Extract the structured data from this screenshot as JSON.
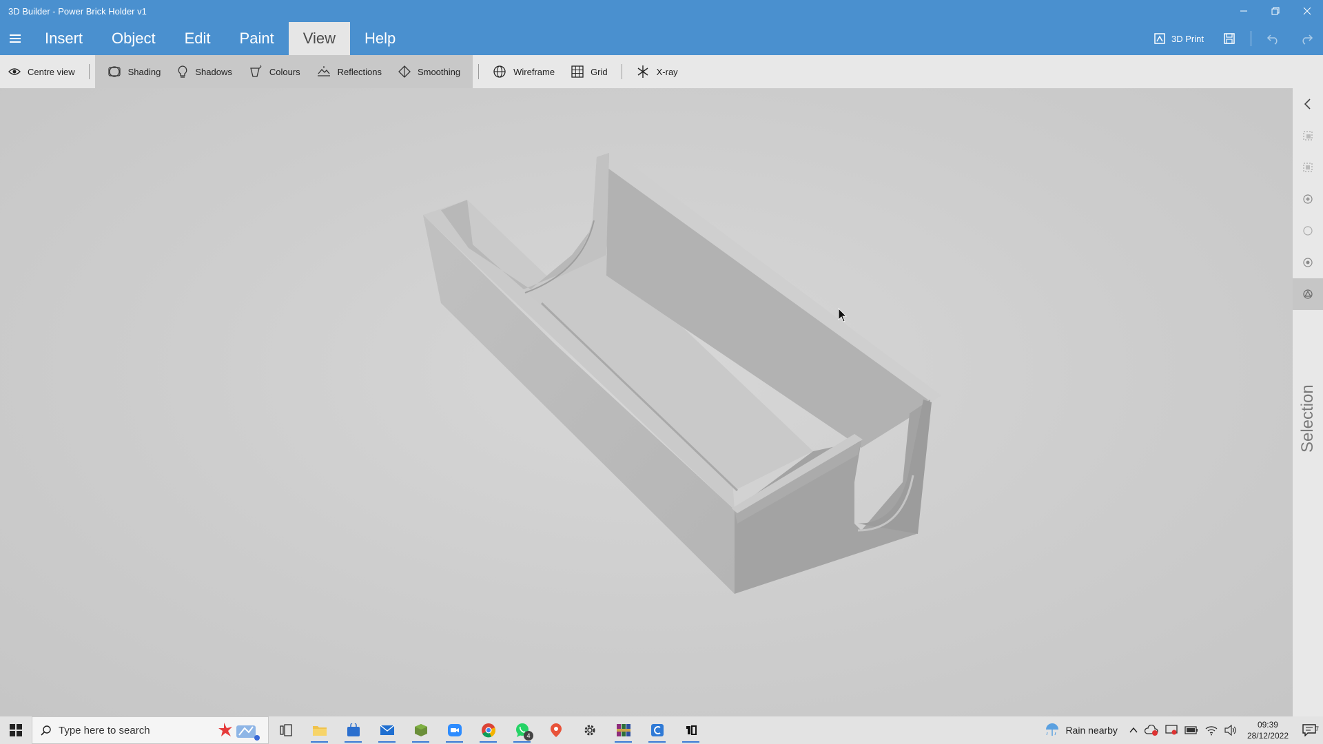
{
  "window": {
    "title": "3D Builder - Power Brick Holder v1",
    "controls": [
      "minimize-icon",
      "restore-icon",
      "close-icon"
    ]
  },
  "menu": {
    "items": [
      {
        "label": "Insert",
        "active": false
      },
      {
        "label": "Object",
        "active": false
      },
      {
        "label": "Edit",
        "active": false
      },
      {
        "label": "Paint",
        "active": false
      },
      {
        "label": "View",
        "active": true
      },
      {
        "label": "Help",
        "active": false
      }
    ],
    "print_label": "3D Print"
  },
  "ribbon": {
    "centre_view": "Centre view",
    "shading": "Shading",
    "shadows": "Shadows",
    "colours": "Colours",
    "reflections": "Reflections",
    "smoothing": "Smoothing",
    "wireframe": "Wireframe",
    "grid": "Grid",
    "xray": "X-ray"
  },
  "sidepanel": {
    "label": "Selection",
    "icons": [
      "chevron-left-icon",
      "select-object-icon",
      "select-mesh-icon",
      "select-face-icon",
      "select-edge-icon",
      "select-vertex-icon",
      "select-region-icon"
    ]
  },
  "taskbar": {
    "search_placeholder": "Type here to search",
    "whatsapp_badge": "4",
    "weather": "Rain nearby",
    "time": "09:39",
    "date": "28/12/2022",
    "notifications": "7"
  },
  "colors": {
    "titlebar": "#4a90cf",
    "ribbon": "#e8e8e8",
    "viewport": "#d0d0d0"
  }
}
